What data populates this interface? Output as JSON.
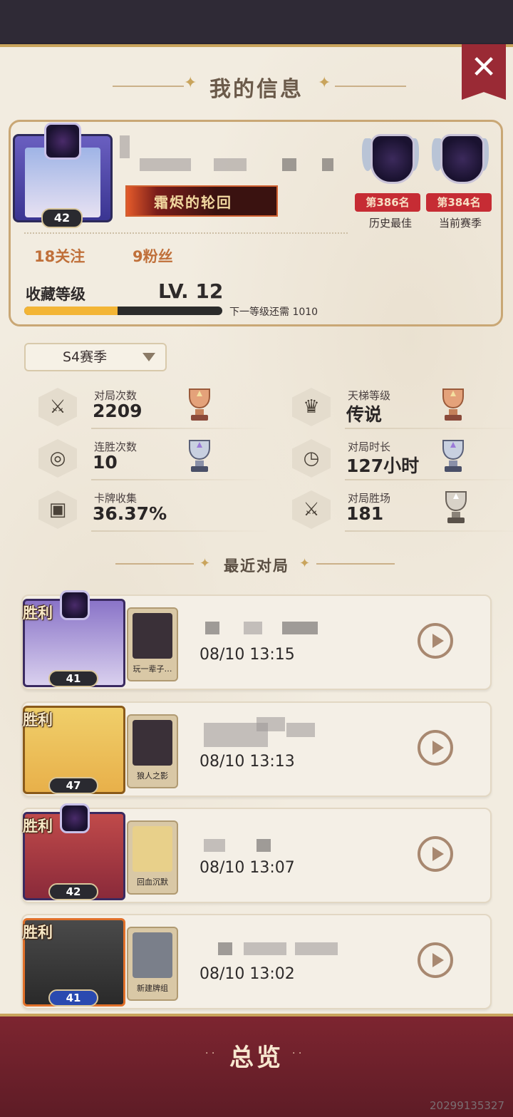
{
  "header": {
    "title": "我的信息",
    "close_icon": "close-icon"
  },
  "profile": {
    "avatar_level": "42",
    "title_banner": "霜烬的轮回",
    "followers_following": "18关注",
    "fans": "9粉丝",
    "collection_label": "收藏等级",
    "collection_level": "LV. 12",
    "collection_progress": 0.47,
    "next_level_text": "下一等级还需 1010",
    "ranks": [
      {
        "rank": "第386名",
        "caption": "历史最佳"
      },
      {
        "rank": "第384名",
        "caption": "当前赛季"
      }
    ]
  },
  "season": {
    "selected": "S4赛季"
  },
  "stats": [
    {
      "label": "对局次数",
      "value": "2209",
      "icon": "swords-icon"
    },
    {
      "label": "天梯等级",
      "value": "传说",
      "icon": "crown-icon"
    },
    {
      "label": "连胜次数",
      "value": "10",
      "icon": "streak-icon"
    },
    {
      "label": "对局时长",
      "value": "127小时",
      "icon": "clock-icon"
    },
    {
      "label": "卡牌收集",
      "value": "36.37%",
      "icon": "card-icon"
    },
    {
      "label": "对局胜场",
      "value": "181",
      "icon": "swords-icon"
    }
  ],
  "recent": {
    "title": "最近对局",
    "matches": [
      {
        "result": "胜利",
        "level": "41",
        "deck": "玩一辈子…",
        "time": "08/10 13:15"
      },
      {
        "result": "胜利",
        "level": "47",
        "deck": "狼人之影",
        "time": "08/10 13:13"
      },
      {
        "result": "胜利",
        "level": "42",
        "deck": "回血沉默",
        "time": "08/10 13:07"
      },
      {
        "result": "胜利",
        "level": "41",
        "deck": "新建牌组",
        "time": "08/10 13:02"
      }
    ]
  },
  "footer": {
    "overview_label": "总览",
    "watermark": "20299135327"
  },
  "colors": {
    "accent": "#9a2a35",
    "progress": "#f3b535",
    "rank_red": "#c62c34",
    "gold": "#c9a45c"
  }
}
